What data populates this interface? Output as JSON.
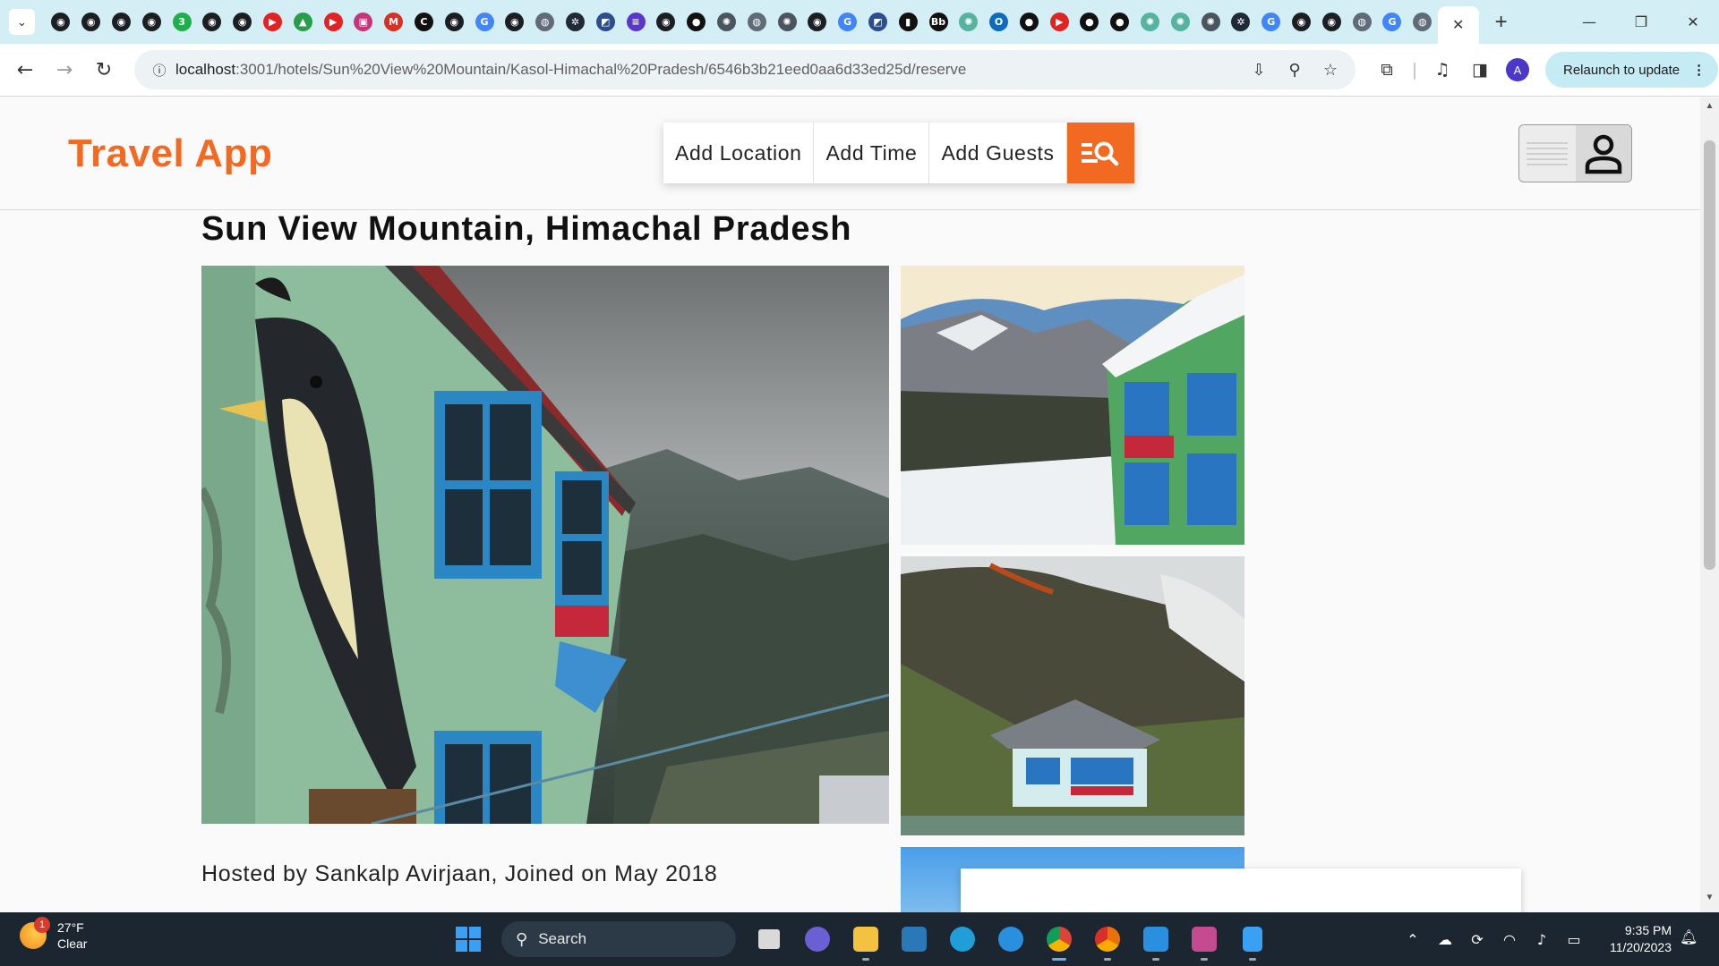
{
  "browser": {
    "favicons": [
      {
        "icon": "github-icon",
        "glyph": "◉",
        "color": "#1b1f23"
      },
      {
        "icon": "github-icon",
        "glyph": "◉",
        "color": "#1b1f23"
      },
      {
        "icon": "github-icon",
        "glyph": "◉",
        "color": "#1b1f23"
      },
      {
        "icon": "github-icon",
        "glyph": "◉",
        "color": "#1b1f23"
      },
      {
        "icon": "green-3-icon",
        "glyph": "3",
        "color": "#1fb04b"
      },
      {
        "icon": "github-icon",
        "glyph": "◉",
        "color": "#1b1f23"
      },
      {
        "icon": "github-icon",
        "glyph": "◉",
        "color": "#1b1f23"
      },
      {
        "icon": "youtube-icon",
        "glyph": "▶",
        "color": "#e02424"
      },
      {
        "icon": "google-drive-icon",
        "glyph": "▲",
        "color": "#2a9d4a"
      },
      {
        "icon": "youtube-icon",
        "glyph": "▶",
        "color": "#e02424"
      },
      {
        "icon": "ticket-icon",
        "glyph": "▣",
        "color": "#c6357a"
      },
      {
        "icon": "gmail-icon",
        "glyph": "M",
        "color": "#d93025"
      },
      {
        "icon": "chegg-icon",
        "glyph": "C",
        "color": "#111111"
      },
      {
        "icon": "github-icon",
        "glyph": "◉",
        "color": "#1b1f23"
      },
      {
        "icon": "google-icon",
        "glyph": "G",
        "color": "#4285f4"
      },
      {
        "icon": "github-icon",
        "glyph": "◉",
        "color": "#1b1f23"
      },
      {
        "icon": "globe-icon",
        "glyph": "◍",
        "color": "#5f6b78"
      },
      {
        "icon": "react-icon",
        "glyph": "✲",
        "color": "#1f2a36"
      },
      {
        "icon": "chart-icon",
        "glyph": "◩",
        "color": "#2b4e8c"
      },
      {
        "icon": "list-icon",
        "glyph": "≡",
        "color": "#5a37c9"
      },
      {
        "icon": "github-icon",
        "glyph": "◉",
        "color": "#1b1f23"
      },
      {
        "icon": "medium-icon",
        "glyph": "●",
        "color": "#111111"
      },
      {
        "icon": "openai-icon",
        "glyph": "✺",
        "color": "#4a5560"
      },
      {
        "icon": "globe-icon",
        "glyph": "◍",
        "color": "#5f6b78"
      },
      {
        "icon": "openai-icon",
        "glyph": "✺",
        "color": "#4a5560"
      },
      {
        "icon": "github-icon",
        "glyph": "◉",
        "color": "#1b1f23"
      },
      {
        "icon": "google-icon",
        "glyph": "G",
        "color": "#4285f4"
      },
      {
        "icon": "chart-icon",
        "glyph": "◩",
        "color": "#2b4e8c"
      },
      {
        "icon": "bar-chart-icon",
        "glyph": "▮",
        "color": "#111111"
      },
      {
        "icon": "bb-icon",
        "glyph": "Bb",
        "color": "#111111"
      },
      {
        "icon": "openai-icon",
        "glyph": "✺",
        "color": "#55b3a0"
      },
      {
        "icon": "outlook-icon",
        "glyph": "O",
        "color": "#0f6cbd"
      },
      {
        "icon": "medium-icon",
        "glyph": "●",
        "color": "#111111"
      },
      {
        "icon": "youtube-icon",
        "glyph": "▶",
        "color": "#e02424"
      },
      {
        "icon": "medium-icon",
        "glyph": "●",
        "color": "#111111"
      },
      {
        "icon": "medium-icon",
        "glyph": "●",
        "color": "#111111"
      },
      {
        "icon": "openai-icon",
        "glyph": "✺",
        "color": "#55b3a0"
      },
      {
        "icon": "openai-icon",
        "glyph": "✺",
        "color": "#55b3a0"
      },
      {
        "icon": "openai-icon",
        "glyph": "✺",
        "color": "#4a5560"
      },
      {
        "icon": "react-icon",
        "glyph": "✲",
        "color": "#1f2a36"
      },
      {
        "icon": "google-icon",
        "glyph": "G",
        "color": "#4285f4"
      },
      {
        "icon": "github-icon",
        "glyph": "◉",
        "color": "#1b1f23"
      },
      {
        "icon": "github-icon",
        "glyph": "◉",
        "color": "#1b1f23"
      },
      {
        "icon": "globe-icon",
        "glyph": "◍",
        "color": "#5f6b78"
      },
      {
        "icon": "google-icon",
        "glyph": "G",
        "color": "#4285f4"
      },
      {
        "icon": "globe-icon",
        "glyph": "◍",
        "color": "#5f6b78"
      }
    ],
    "active_tab_close": "✕",
    "new_tab": "+",
    "window": {
      "minimize": "—",
      "restore": "❐",
      "close": "✕"
    },
    "nav": {
      "back": "←",
      "forward": "→",
      "reload": "↻"
    },
    "url_host": "localhost",
    "url_rest": ":3001/hotels/Sun%20View%20Mountain/Kasol-Himachal%20Pradesh/6546b3b21eed0aa6d33ed25d/reserve",
    "avatar_letter": "A",
    "relaunch_label": "Relaunch to update",
    "relaunch_menu": "⋮"
  },
  "app": {
    "brand": "Travel App",
    "brand_color": "#f26a21",
    "search": {
      "location": "Add Location",
      "time": "Add Time",
      "guests": "Add Guests"
    }
  },
  "hotel": {
    "title": "Sun View Mountain, Himachal Pradesh",
    "host_line": "Hosted by Sankalp Avirjaan, Joined on May 2018"
  },
  "taskbar": {
    "weather_temp": "27°F",
    "weather_desc": "Clear",
    "weather_badge": "1",
    "search_label": "Search",
    "time": "9:35 PM",
    "date": "11/20/2023",
    "apps": [
      {
        "icon": "windows-start-icon",
        "color": "#3aa0f3"
      },
      {
        "icon": "search-box"
      },
      {
        "icon": "task-view-icon",
        "color": "#d9d9d9"
      },
      {
        "icon": "teams-chat-icon",
        "color": "#6b5fd3"
      },
      {
        "icon": "file-explorer-icon",
        "color": "#f4c241"
      },
      {
        "icon": "mysql-workbench-icon",
        "color": "#2a78b5"
      },
      {
        "icon": "edge-icon",
        "color": "#1f9ed8"
      },
      {
        "icon": "help-icon",
        "color": "#2b8fe0"
      },
      {
        "icon": "chrome-icon",
        "color": "#e9b21d"
      },
      {
        "icon": "chrome-canary-icon",
        "color": "#f1a12a"
      },
      {
        "icon": "vscode-icon",
        "color": "#2b8fe0"
      },
      {
        "icon": "snipping-tool-icon",
        "color": "#c44b8f"
      },
      {
        "icon": "notepad-icon",
        "color": "#3aa0f3"
      }
    ]
  }
}
